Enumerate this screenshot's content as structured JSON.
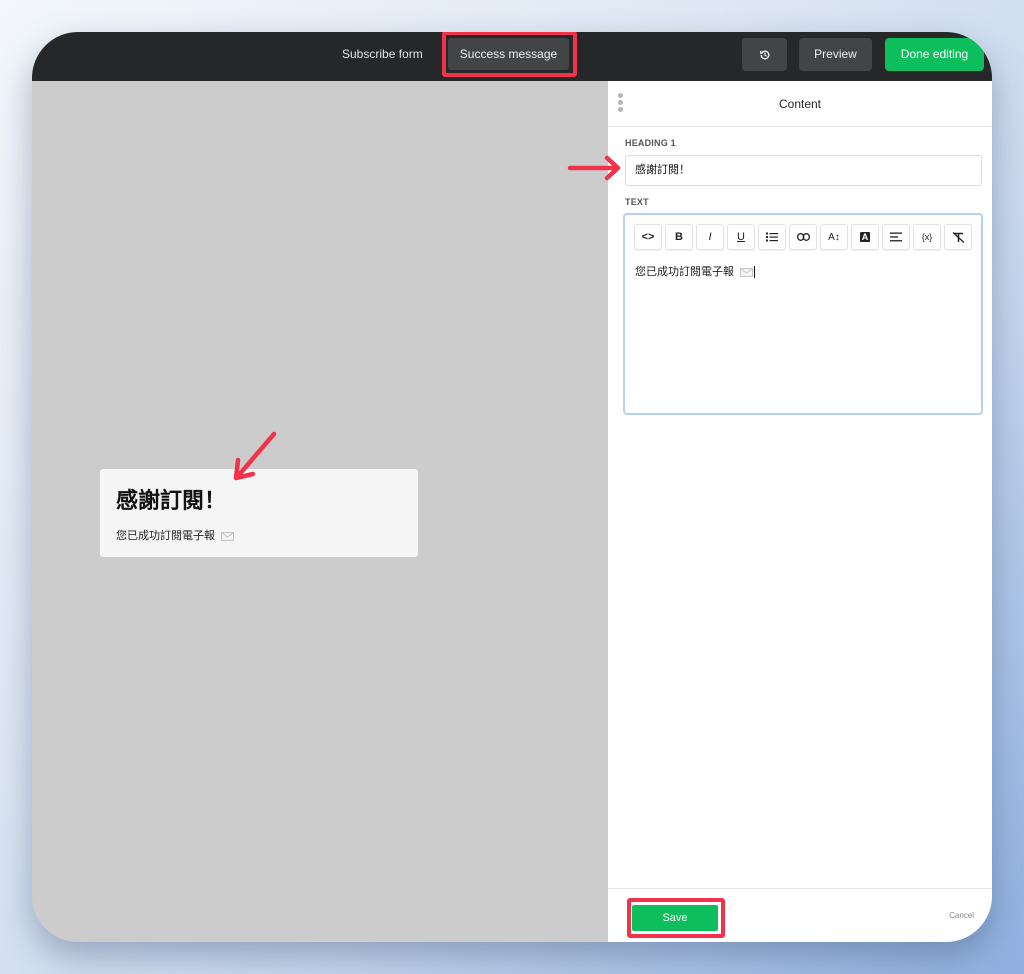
{
  "topbar": {
    "tabs": [
      {
        "label": "Subscribe form"
      },
      {
        "label": "Success message"
      }
    ],
    "history_icon": "history-icon",
    "preview_label": "Preview",
    "done_label": "Done editing"
  },
  "preview": {
    "heading": "感謝訂閱！",
    "text": "您已成功訂閱電子報",
    "text_icon": "envelope-icon"
  },
  "panel": {
    "title": "Content",
    "heading_label": "HEADING 1",
    "heading_value": "感謝訂閱！",
    "text_label": "TEXT",
    "toolbar": [
      {
        "name": "code",
        "glyph": "<>"
      },
      {
        "name": "bold",
        "glyph": "B"
      },
      {
        "name": "italic",
        "glyph": "I"
      },
      {
        "name": "underline",
        "glyph": "U"
      },
      {
        "name": "list",
        "glyph": "list-icon"
      },
      {
        "name": "link",
        "glyph": "link-icon"
      },
      {
        "name": "font-size",
        "glyph": "A↕"
      },
      {
        "name": "text-color",
        "glyph": "A"
      },
      {
        "name": "align",
        "glyph": "align-icon"
      },
      {
        "name": "variable",
        "glyph": "{x}"
      },
      {
        "name": "clear-format",
        "glyph": "clear-format-icon"
      }
    ],
    "text_value": "您已成功訂閱電子報",
    "save_label": "Save",
    "cancel_label": "Cancel"
  },
  "colors": {
    "accent_green": "#0cbf5c",
    "highlight_red": "#f0324a",
    "topbar_bg": "#262729"
  }
}
